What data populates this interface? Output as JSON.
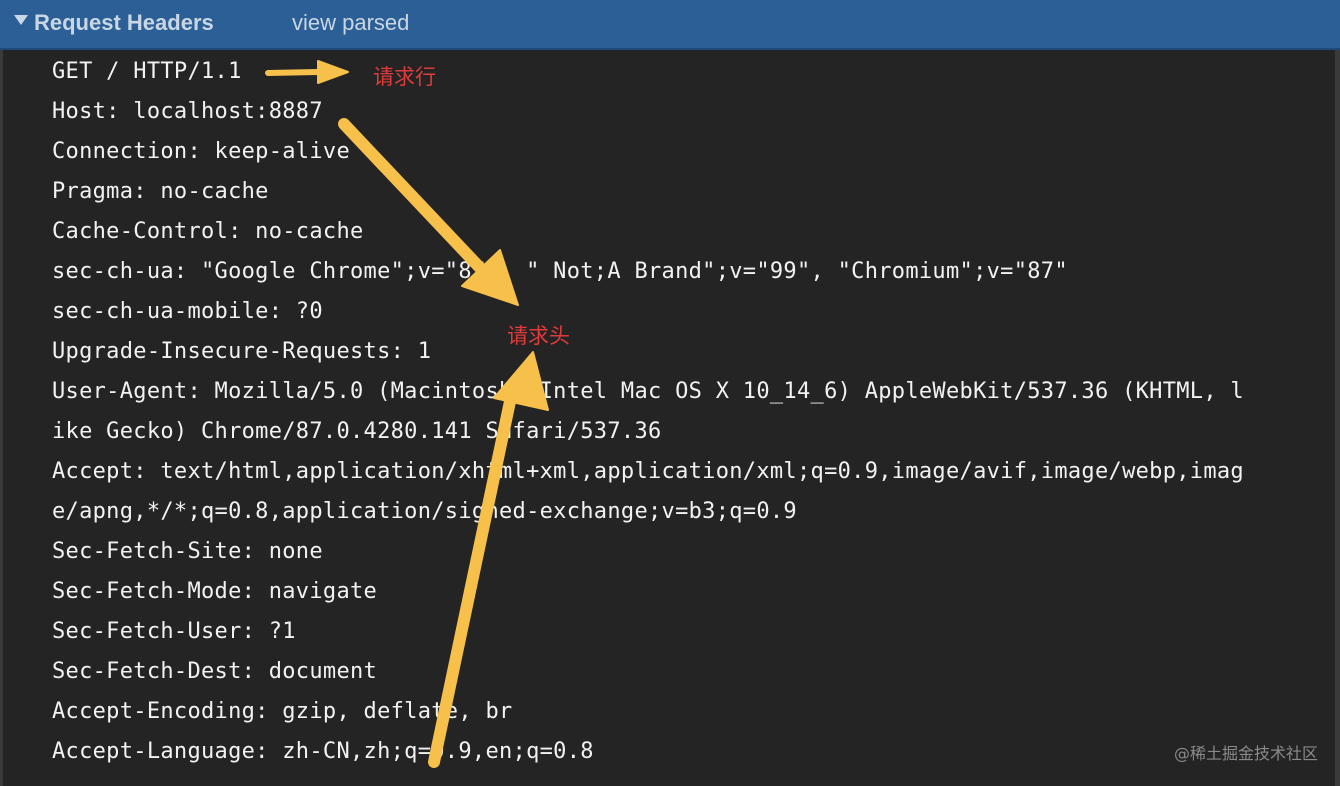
{
  "panel": {
    "title": "Request Headers",
    "view_parsed_label": "view parsed"
  },
  "headers": [
    "GET / HTTP/1.1",
    "Host: localhost:8887",
    "Connection: keep-alive",
    "Pragma: no-cache",
    "Cache-Control: no-cache",
    "sec-ch-ua: \"Google Chrome\";v=\"87\", \" Not;A Brand\";v=\"99\", \"Chromium\";v=\"87\"",
    "sec-ch-ua-mobile: ?0",
    "Upgrade-Insecure-Requests: 1",
    "User-Agent: Mozilla/5.0 (Macintosh; Intel Mac OS X 10_14_6) AppleWebKit/537.36 (KHTML, l",
    "ike Gecko) Chrome/87.0.4280.141 Safari/537.36",
    "Accept: text/html,application/xhtml+xml,application/xml;q=0.9,image/avif,image/webp,imag",
    "e/apng,*/*;q=0.8,application/signed-exchange;v=b3;q=0.9",
    "Sec-Fetch-Site: none",
    "Sec-Fetch-Mode: navigate",
    "Sec-Fetch-User: ?1",
    "Sec-Fetch-Dest: document",
    "Accept-Encoding: gzip, deflate, br",
    "Accept-Language: zh-CN,zh;q=0.9,en;q=0.8"
  ],
  "annotations": {
    "request_line": "请求行",
    "request_headers": "请求头"
  },
  "watermark": "@稀土掘金技术社区",
  "colors": {
    "header_bar": "#2b5f95",
    "background": "#242424",
    "arrow": "#f7c04a",
    "annotation_text": "#e03b3b"
  }
}
